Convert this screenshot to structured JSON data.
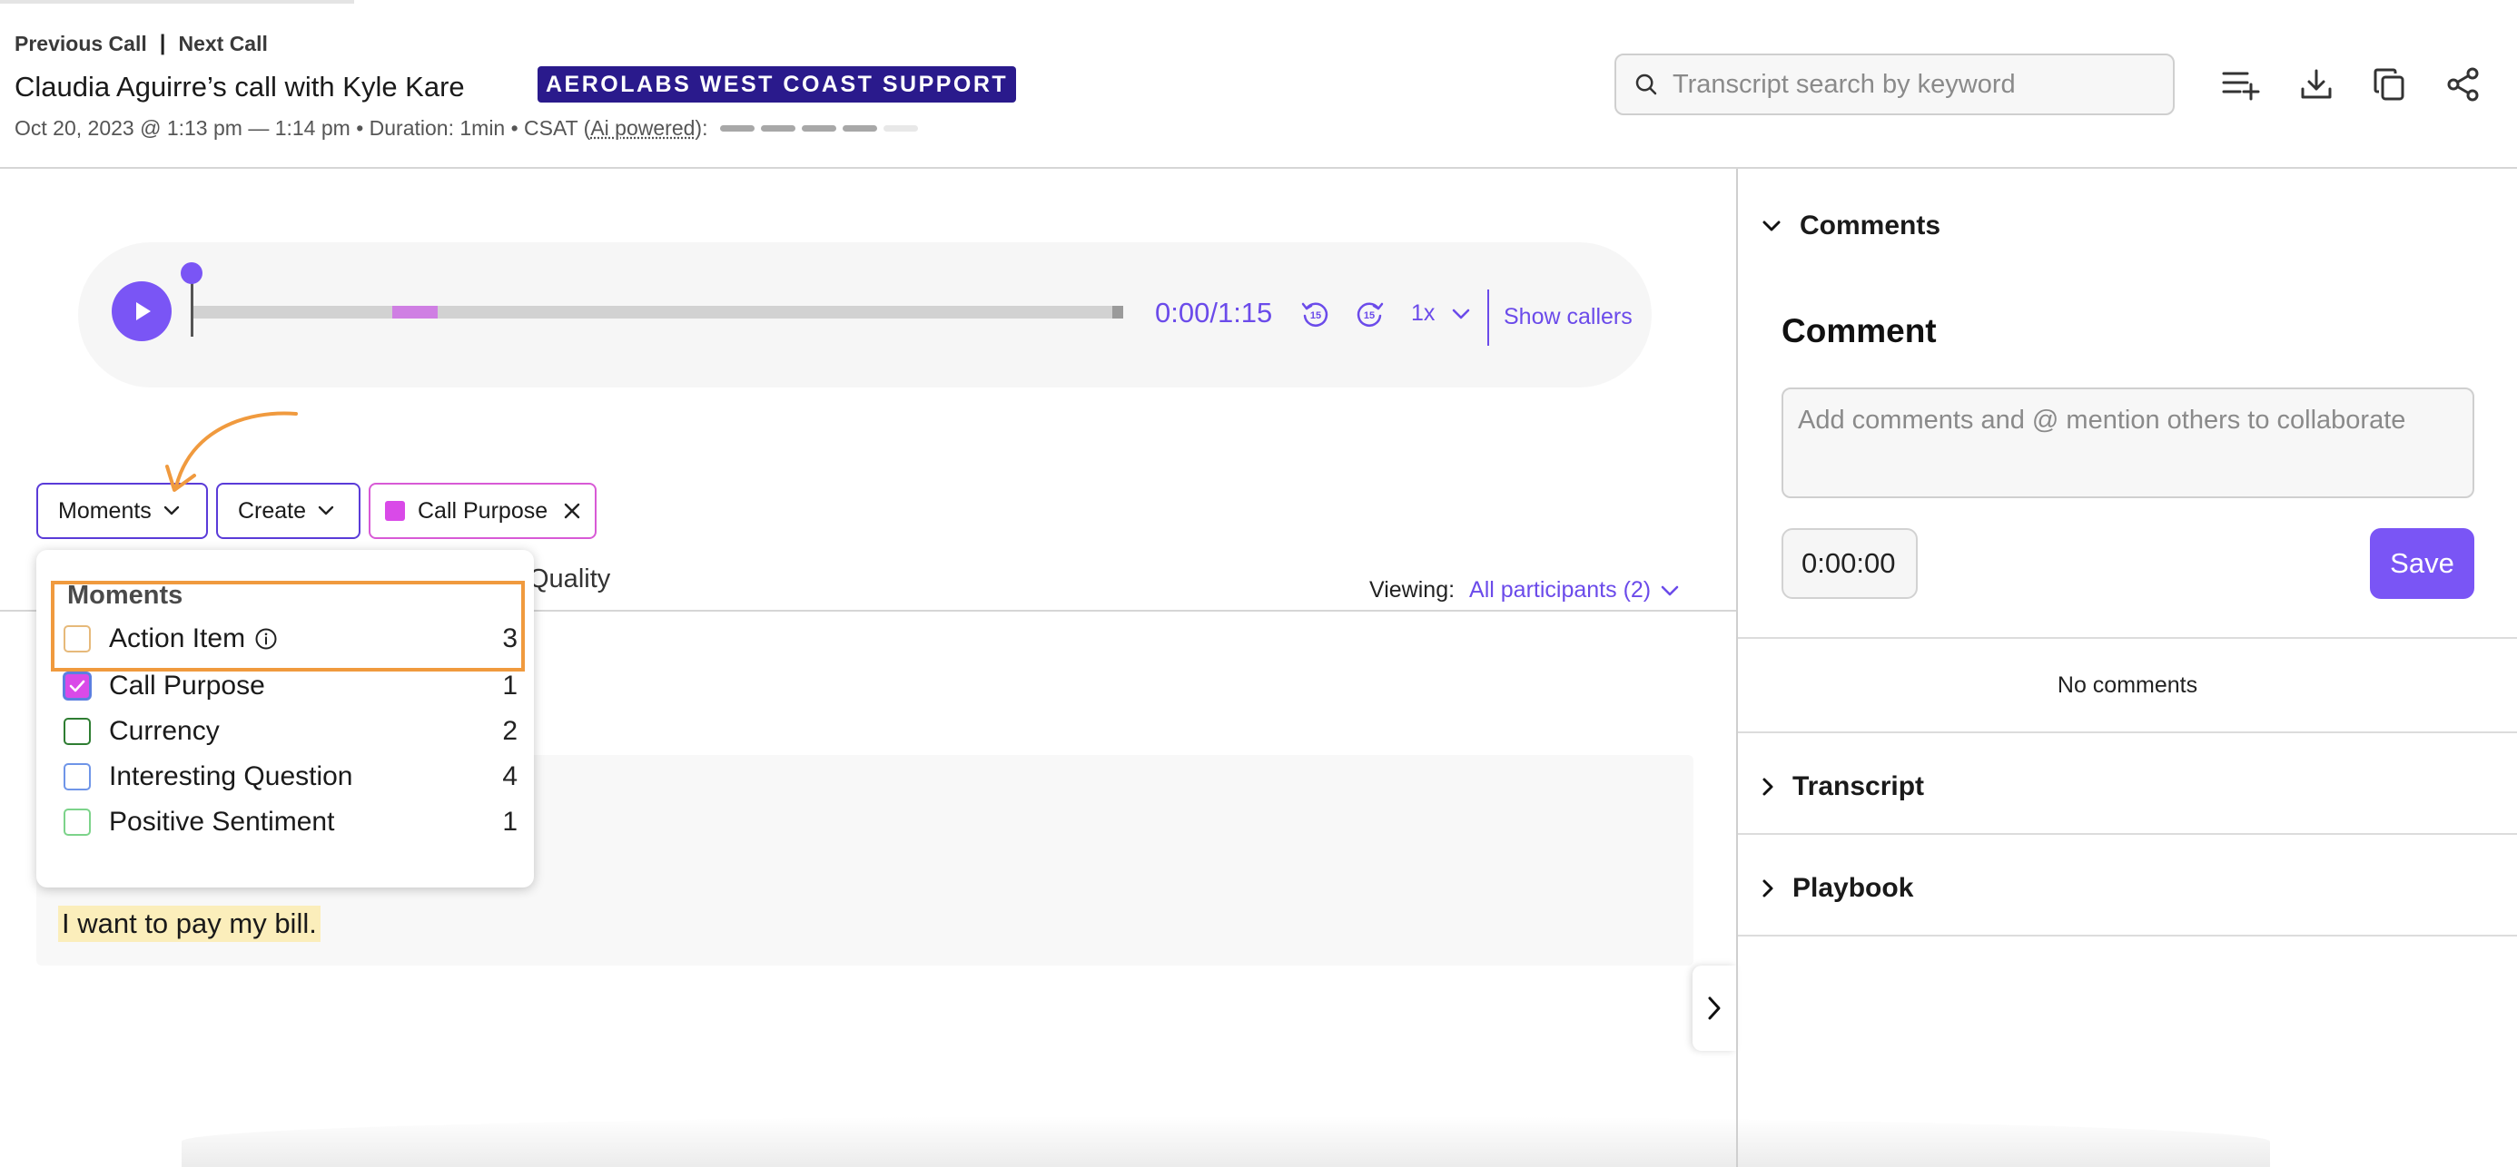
{
  "header": {
    "prev_call": "Previous Call",
    "separator": "|",
    "next_call": "Next Call",
    "title": "Claudia Aguirre’s call with Kyle Kare",
    "team_badge": "AEROLABS WEST COAST SUPPORT",
    "meta_prefix": "Oct 20, 2023 @ 1:13 pm — 1:14 pm • Duration: 1min • CSAT (",
    "meta_ai": "Ai powered",
    "meta_suffix": "):",
    "csat_level": 4,
    "csat_max": 5,
    "search_placeholder": "Transcript search by keyword",
    "icons": [
      "add-to-playlist-icon",
      "download-icon",
      "copy-icon",
      "share-icon"
    ]
  },
  "player": {
    "time": "0:00/1:15",
    "rewind_label": "15",
    "forward_label": "15",
    "speed": "1x",
    "show_callers": "Show callers",
    "progress_fraction": 0.0
  },
  "filters": {
    "moments_label": "Moments",
    "create_label": "Create",
    "active_chip": "Call Purpose",
    "active_chip_color": "#d94ae8"
  },
  "tabs": {
    "quality_fragment": "Quality",
    "viewing_label": "Viewing:",
    "viewing_value": "All participants (2)"
  },
  "transcript": {
    "line": "I want to pay my bill."
  },
  "moments_dropdown": {
    "title": "Moments",
    "items": [
      {
        "label": "Action Item",
        "count": "3",
        "checked": false,
        "color": "#e6b97a",
        "has_info": true
      },
      {
        "label": "Call Purpose",
        "count": "1",
        "checked": true,
        "color": "#d94ae8",
        "has_info": false
      },
      {
        "label": "Currency",
        "count": "2",
        "checked": false,
        "color": "#2e7d32",
        "has_info": false
      },
      {
        "label": "Interesting Question",
        "count": "4",
        "checked": false,
        "color": "#6f95e8",
        "has_info": false
      },
      {
        "label": "Positive Sentiment",
        "count": "1",
        "checked": false,
        "color": "#7cd38a",
        "has_info": false
      }
    ]
  },
  "right_panel": {
    "comments_section": "Comments",
    "comment_heading": "Comment",
    "comment_placeholder": "Add comments and @ mention others to collaborate",
    "timestamp": "0:00:00",
    "save_label": "Save",
    "no_comments": "No comments",
    "transcript_section": "Transcript",
    "playbook_section": "Playbook"
  },
  "colors": {
    "accent": "#7a55f5",
    "badge_bg": "#2a1a8c",
    "annotation": "#f09a3e"
  }
}
